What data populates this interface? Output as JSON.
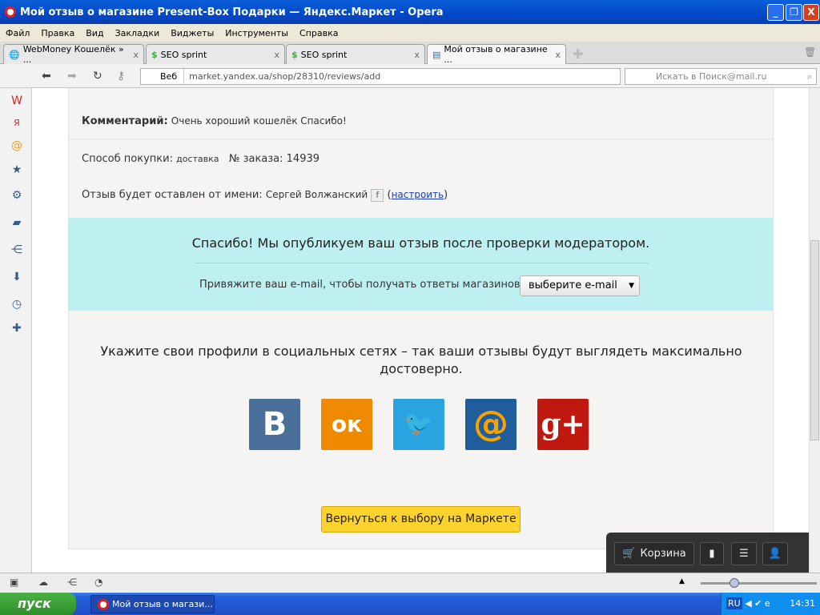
{
  "window": {
    "title": "Мой отзыв о магазине Present-Box Подарки — Яндекс.Маркет - Opera"
  },
  "menu": [
    "Файл",
    "Правка",
    "Вид",
    "Закладки",
    "Виджеты",
    "Инструменты",
    "Справка"
  ],
  "tabs": [
    {
      "label": "WebMoney Кошелёк » ..."
    },
    {
      "label": "SEO sprint"
    },
    {
      "label": "SEO sprint"
    },
    {
      "label": "Мой отзыв о магазине ..."
    }
  ],
  "address": {
    "scope": "Веб",
    "url": "market.yandex.ua/shop/28310/reviews/add",
    "search_placeholder": "Искать в Поиск@mail.ru"
  },
  "review": {
    "comment_label": "Комментарий:",
    "comment": "Очень хороший кошелёк Спасибо!",
    "purchase_label": "Способ покупки:",
    "purchase": "доставка",
    "order_label": "№ заказа: 14939",
    "author_label": "Отзыв будет оставлен от имени:",
    "author": "Сергей Волжанский",
    "settings_open": "(",
    "settings": "настроить",
    "settings_close": ")"
  },
  "notice": {
    "thanks": "Спасибо! Мы опубликуем ваш отзыв после проверки модератором.",
    "email_prompt": "Привяжите ваш e-mail, чтобы получать ответы магазинов",
    "email_select": "выберите e-mail"
  },
  "social": {
    "prompt": "Укажите свои профили в социальных сетях – так ваши отзывы будут выглядеть максимально достоверно.",
    "networks": [
      {
        "name": "vk",
        "glyph": "B",
        "color": "#4b6f9b"
      },
      {
        "name": "odnoklassniki",
        "glyph": "ок",
        "color": "#ef8a00"
      },
      {
        "name": "twitter",
        "glyph": "🐦",
        "color": "#2ba3e1"
      },
      {
        "name": "mail",
        "glyph": "@",
        "color": "#1f5d9c"
      },
      {
        "name": "google-plus",
        "glyph": "g+",
        "color": "#c0180f"
      }
    ]
  },
  "back_button": "Вернуться к выбору на Маркете",
  "market_bar": {
    "cart": "Корзина"
  },
  "taskbar": {
    "start": "пуск",
    "task": "Мой отзыв о магази...",
    "lang": "RU",
    "time": "14:31"
  }
}
